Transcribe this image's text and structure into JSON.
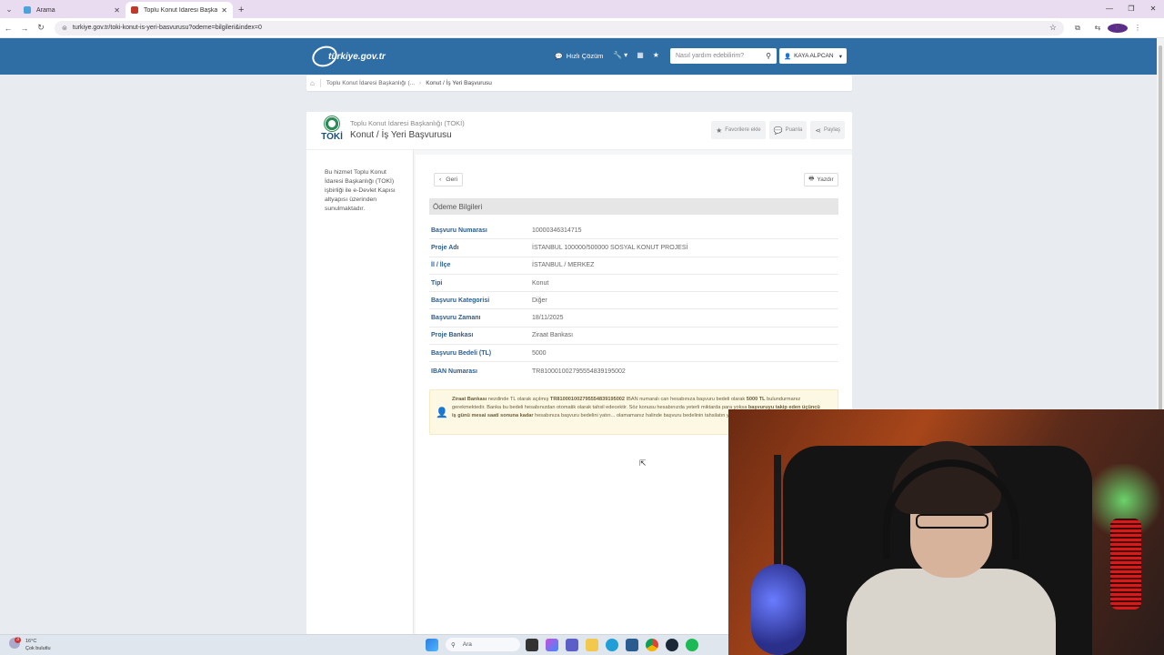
{
  "browser": {
    "tabs": [
      {
        "label": "Arama",
        "active": false,
        "favicon_color": "#4aa3df"
      },
      {
        "label": "Toplu Konut İdaresi Başkanlığı",
        "active": true,
        "favicon_color": "#c0392b"
      }
    ],
    "url": "turkiye.gov.tr/toki-konut-is-yeri-basvurusu?odeme=bilgileri&index=0"
  },
  "header": {
    "logo_text": "türkiye.gov.tr",
    "quick_solution": "Hızlı Çözüm",
    "search_placeholder": "Nasıl yardım edebilirim?",
    "user_name": "KAYA ALPCAN"
  },
  "breadcrumb": {
    "items": [
      "Toplu Konut İdaresi Başkanlığı (...",
      "Konut / İş Yeri Başvurusu"
    ]
  },
  "page": {
    "org": "Toplu Konut İdaresi Başkanlığı (TOKİ)",
    "title": "Konut / İş Yeri Başvurusu",
    "logo_word": "TOKİ",
    "actions": {
      "favorite": "Favorilere ekle",
      "rate": "Puanla",
      "share": "Paylaş"
    },
    "sidebar_text": "Bu hizmet Toplu Konut İdaresi Başkanlığı (TOKİ) işbirliği ile e-Devlet Kapısı altyapısı üzerinden sunulmaktadır.",
    "back": "Geri",
    "print": "Yazdır",
    "section_title": "Ödeme Bilgileri",
    "fields": [
      {
        "label": "Başvuru Numarası",
        "value": "10000346314715"
      },
      {
        "label": "Proje Adı",
        "value": "İSTANBUL 100000/500000 SOSYAL KONUT PROJESİ"
      },
      {
        "label": "İl / İlçe",
        "value": "İSTANBUL / MERKEZ"
      },
      {
        "label": "Tipi",
        "value": "Konut"
      },
      {
        "label": "Başvuru Kategorisi",
        "value": "Diğer"
      },
      {
        "label": "Başvuru Zamanı",
        "value": "18/11/2025"
      },
      {
        "label": "Proje Bankası",
        "value": "Ziraat Bankası"
      },
      {
        "label": "Başvuru Bedeli (TL)",
        "value": "5000"
      },
      {
        "label": "IBAN Numarası",
        "value": "TR810001002795554839195002"
      }
    ],
    "notice": {
      "bank": "Ziraat Bankası",
      "t1": " nezdinde TL olarak açılmış ",
      "iban": "TR810001002795554839195002",
      "t2": " IBAN numaralı can hesabınıza başvuru bedeli olarak ",
      "amount": "5000 TL",
      "t3": " bulundurmanız gerekmektedir. Banka bu bedeli hesabınızdan otomatik olarak tahsil edecektir. Söz konusu hesabınızda yeterli miktarda para yoksa ",
      "bold2": "başvuruyu takip eden üçüncü iş günü mesai saati sonuna kadar",
      "t4": " hesabınıza başvuru bedelini yatırı... olamamanız halinde başvuru bedelinin tahsilatın yapıldığı hesabınıza iade edilecektir."
    }
  },
  "taskbar": {
    "temperature": "16°C",
    "weather": "Çok bulutlu",
    "badge": "3",
    "search": "Ara"
  }
}
